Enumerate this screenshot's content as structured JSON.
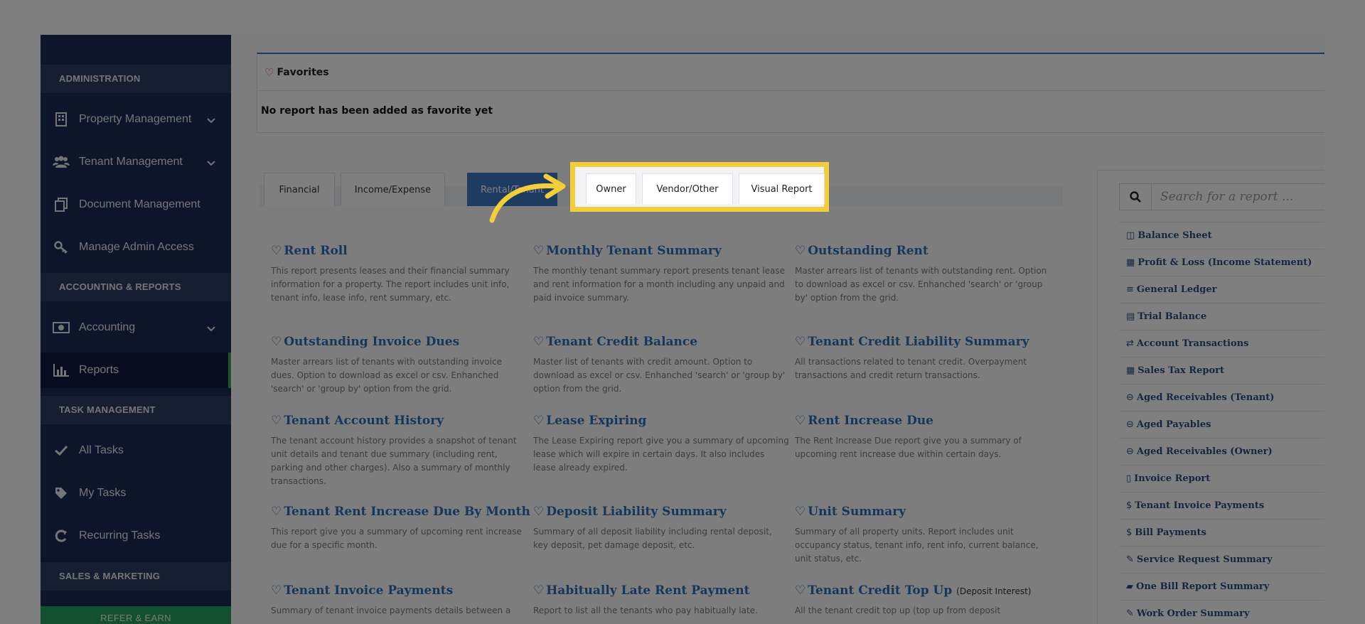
{
  "sidebar": {
    "sections": {
      "administration": "ADMINISTRATION",
      "accounting": "ACCOUNTING & REPORTS",
      "tasks": "TASK MANAGEMENT",
      "sales": "SALES & MARKETING"
    },
    "items": {
      "property": "Property Management",
      "tenant": "Tenant Management",
      "document": "Document Management",
      "admin_access": "Manage Admin Access",
      "accounting": "Accounting",
      "reports": "Reports",
      "all_tasks": "All Tasks",
      "my_tasks": "My Tasks",
      "recurring": "Recurring Tasks"
    },
    "refer": "REFER & EARN"
  },
  "favorites": {
    "title": "Favorites",
    "empty": "No report has been added as favorite yet"
  },
  "tabs": {
    "financial": "Financial",
    "income_expense": "Income/Expense",
    "rental": "Rental/Tenant",
    "owner": "Owner",
    "vendor": "Vendor/Other",
    "visual": "Visual Report"
  },
  "reports": [
    {
      "title": "Rent Roll",
      "desc": "This report presents leases and their financial summary information for a property. The report includes unit info, tenant info, lease info, rent summary, etc."
    },
    {
      "title": "Monthly Tenant Summary",
      "desc": "The monthly tenant summary report presents tenant lease and rent information for a month including any unpaid and paid invoice summary."
    },
    {
      "title": "Outstanding Rent",
      "desc": "Master arrears list of tenants with outstanding rent. Option to download as excel or csv. Enhanched 'search' or 'group by' option from the grid."
    },
    {
      "title": "Outstanding Invoice Dues",
      "desc": "Master arrears list of tenants with outstanding invoice dues. Option to download as excel or csv. Enhanched 'search' or 'group by' option from the grid."
    },
    {
      "title": "Tenant Credit Balance",
      "desc": "Master list of tenants with credit amount. Option to download as excel or csv. Enhanched 'search' or 'group by' option from the grid."
    },
    {
      "title": "Tenant Credit Liability Summary",
      "desc": "All transactions related to tenant credit. Overpayment transactions and credit return transactions."
    },
    {
      "title": "Tenant Account History",
      "desc": "The tenant account history provides a snapshot of tenant unit details and tenant due summary (including rent, parking and other charges). Also a summary of monthly transactions."
    },
    {
      "title": "Lease Expiring",
      "desc": "The Lease Expiring report give you a summary of upcoming lease which will expire in certain days. It also includes lease already expired."
    },
    {
      "title": "Rent Increase Due",
      "desc": "The Rent Increase Due report give you a summary of upcoming rent increase due within certain days."
    },
    {
      "title": "Tenant Rent Increase Due By Month",
      "desc": "This report give you a summary of upcoming rent increase due for a specific month."
    },
    {
      "title": "Deposit Liability Summary",
      "desc": "Summary of all deposit liability including rental deposit, key deposit, pet damage deposit, etc."
    },
    {
      "title": "Unit Summary",
      "desc": "Summary of all property units. Report includes unit occupancy status, tenant info, rent info, current balance, unit status, etc."
    },
    {
      "title": "Tenant Invoice Payments",
      "desc": "Summary of tenant invoice payments details between a"
    },
    {
      "title": "Habitually Late Rent Payment",
      "desc": "Report to list all the tenants who pay habitually late."
    },
    {
      "title": "Tenant Credit Top Up",
      "subtitle": "(Deposit Interest)",
      "desc": "All the tenant credit top up (top up from deposit"
    }
  ],
  "search": {
    "placeholder": "Search for a report ..."
  },
  "quick_list": [
    {
      "icon": "◫",
      "label": "Balance Sheet"
    },
    {
      "icon": "▦",
      "label": "Profit & Loss (Income Statement)"
    },
    {
      "icon": "≡",
      "label": "General Ledger"
    },
    {
      "icon": "▤",
      "label": "Trial Balance"
    },
    {
      "icon": "⇄",
      "label": "Account Transactions"
    },
    {
      "icon": "▦",
      "label": "Sales Tax Report"
    },
    {
      "icon": "⊖",
      "label": "Aged Receivables (Tenant)"
    },
    {
      "icon": "⊖",
      "label": "Aged Payables"
    },
    {
      "icon": "⊖",
      "label": "Aged Receivables (Owner)"
    },
    {
      "icon": "▯",
      "label": "Invoice Report"
    },
    {
      "icon": "$",
      "label": "Tenant Invoice Payments"
    },
    {
      "icon": "$",
      "label": "Bill Payments"
    },
    {
      "icon": "✎",
      "label": "Service Request Summary"
    },
    {
      "icon": "▰",
      "label": "One Bill Report Summary"
    },
    {
      "icon": "✎",
      "label": "Work Order Summary"
    }
  ],
  "colors": {
    "highlight": "#f2cf3a",
    "sidebar": "#1a2a57",
    "accent": "#3d79c4",
    "link": "#2d6db5"
  }
}
